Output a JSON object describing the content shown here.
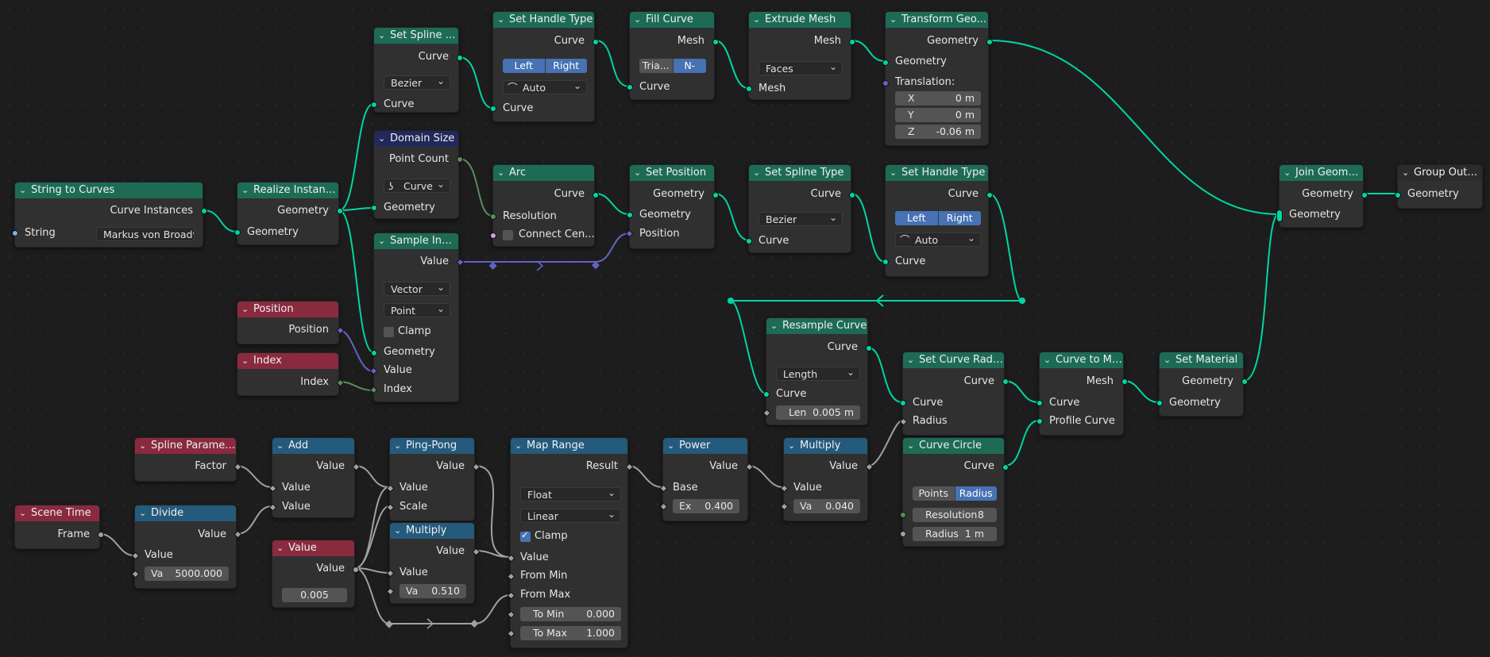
{
  "colors": {
    "geometry": "#00d6a3",
    "vector": "#6363c7",
    "float": "#a1a1a1",
    "integer": "#598c5c",
    "string": "#70b2ff",
    "boolean": "#cca6d6",
    "accent": "#4772b3"
  },
  "icons": {
    "collapse": "chevron-down-icon",
    "curve_type": "curve-icon",
    "handle": "handle-auto-icon"
  },
  "nodes": {
    "string_to_curves": {
      "title": "String to Curves",
      "out_curve_instances": "Curve Instances",
      "in_string": "String",
      "string_value": "Markus von Broady"
    },
    "realize_instances": {
      "title": "Realize Instances",
      "out_geometry": "Geometry",
      "in_geometry": "Geometry"
    },
    "set_spline_type_1": {
      "title": "Set Spline T...",
      "out_curve": "Curve",
      "type": "Bezier",
      "in_curve": "Curve"
    },
    "set_handle_type_1": {
      "title": "Set Handle Type",
      "out_curve": "Curve",
      "left": "Left",
      "right": "Right",
      "mode": "Auto",
      "in_curve": "Curve"
    },
    "fill_curve": {
      "title": "Fill Curve",
      "out_mesh": "Mesh",
      "tri": "Tria...",
      "ngons": "N-gons",
      "in_curve": "Curve"
    },
    "extrude_mesh": {
      "title": "Extrude Mesh",
      "out_mesh": "Mesh",
      "mode": "Faces",
      "in_mesh": "Mesh"
    },
    "transform_geometry": {
      "title": "Transform Geo...",
      "out_geometry": "Geometry",
      "in_geometry": "Geometry",
      "translation": "Translation:",
      "x_label": "X",
      "x_val": "0 m",
      "y_label": "Y",
      "y_val": "0 m",
      "z_label": "Z",
      "z_val": "-0.06 m"
    },
    "domain_size": {
      "title": "Domain Size",
      "out_point_count": "Point Count",
      "component": "Curve",
      "in_geometry": "Geometry"
    },
    "arc": {
      "title": "Arc",
      "out_curve": "Curve",
      "in_resolution": "Resolution",
      "in_connect_center": "Connect Cen..."
    },
    "set_position": {
      "title": "Set Position",
      "out_geometry": "Geometry",
      "in_geometry": "Geometry",
      "in_position": "Position"
    },
    "set_spline_type_2": {
      "title": "Set Spline Type",
      "out_curve": "Curve",
      "type": "Bezier",
      "in_curve": "Curve"
    },
    "set_handle_type_2": {
      "title": "Set Handle Type",
      "out_curve": "Curve",
      "left": "Left",
      "right": "Right",
      "mode": "Auto",
      "in_curve": "Curve"
    },
    "join_geometry": {
      "title": "Join Geometry",
      "out_geometry": "Geometry",
      "in_geometry": "Geometry"
    },
    "group_output": {
      "title": "Group Output",
      "in_geometry": "Geometry"
    },
    "sample_index": {
      "title": "Sample Index",
      "out_value": "Value",
      "data_type": "Vector",
      "domain": "Point",
      "clamp": "Clamp",
      "in_geometry": "Geometry",
      "in_value": "Value",
      "in_index": "Index"
    },
    "position": {
      "title": "Position",
      "out_position": "Position"
    },
    "index": {
      "title": "Index",
      "out_index": "Index"
    },
    "resample_curve": {
      "title": "Resample Curve",
      "out_curve": "Curve",
      "mode": "Length",
      "in_curve": "Curve",
      "len_label": "Len",
      "len_val": "0.005 m"
    },
    "set_curve_radius": {
      "title": "Set Curve Radius",
      "out_curve": "Curve",
      "in_curve": "Curve",
      "in_radius": "Radius"
    },
    "curve_to_mesh": {
      "title": "Curve to Mesh",
      "out_mesh": "Mesh",
      "in_curve": "Curve",
      "in_profile": "Profile Curve"
    },
    "set_material": {
      "title": "Set Material",
      "out_geometry": "Geometry",
      "in_geometry": "Geometry"
    },
    "curve_circle": {
      "title": "Curve Circle",
      "out_curve": "Curve",
      "points": "Points",
      "radius_mode": "Radius",
      "res_label": "Resolution",
      "res_val": "8",
      "rad_label": "Radius",
      "rad_val": "1 m"
    },
    "spline_parameter": {
      "title": "Spline Parameter",
      "out_factor": "Factor"
    },
    "add": {
      "title": "Add",
      "out_value": "Value",
      "in_value_1": "Value",
      "in_value_2": "Value"
    },
    "ping_pong": {
      "title": "Ping-Pong",
      "out_value": "Value",
      "in_value": "Value",
      "in_scale": "Scale"
    },
    "map_range": {
      "title": "Map Range",
      "out_result": "Result",
      "data_type": "Float",
      "interp": "Linear",
      "clamp": "Clamp",
      "in_value": "Value",
      "in_from_min": "From Min",
      "in_from_max": "From Max",
      "to_min_label": "To Min",
      "to_min_val": "0.000",
      "to_max_label": "To Max",
      "to_max_val": "1.000"
    },
    "power": {
      "title": "Power",
      "out_value": "Value",
      "in_base": "Base",
      "ex_label": "Ex",
      "ex_val": "0.400"
    },
    "multiply_1": {
      "title": "Multiply",
      "out_value": "Value",
      "in_value": "Value",
      "va_label": "Va",
      "va_val": "0.040"
    },
    "scene_time": {
      "title": "Scene Time",
      "out_frame": "Frame"
    },
    "divide": {
      "title": "Divide",
      "out_value": "Value",
      "in_value": "Value",
      "va_label": "Va",
      "va_val": "5000.000"
    },
    "value": {
      "title": "Value",
      "out_value": "Value",
      "value": "0.005"
    },
    "multiply_2": {
      "title": "Multiply",
      "out_value": "Value",
      "in_value": "Value",
      "va_label": "Va",
      "va_val": "0.510"
    }
  }
}
